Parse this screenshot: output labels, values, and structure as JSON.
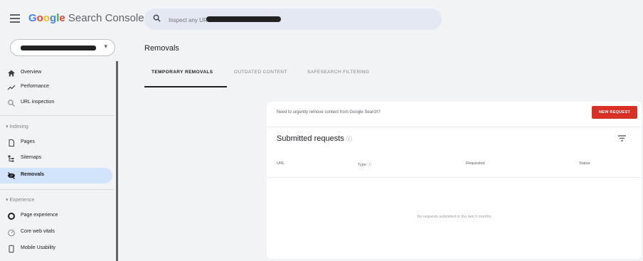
{
  "app": {
    "brand_text": "Search Console",
    "brand_google_letters": [
      "G",
      "o",
      "o",
      "g",
      "l",
      "e"
    ],
    "brand_colors": [
      "#4285f4",
      "#ea4335",
      "#fbbc05",
      "#4285f4",
      "#34a853",
      "#ea4335"
    ]
  },
  "search": {
    "placeholder": "Inspect any URL in"
  },
  "sidebar": {
    "items_top": [
      {
        "label": "Overview",
        "icon": "home-icon"
      },
      {
        "label": "Performance",
        "icon": "trending-up-icon"
      },
      {
        "label": "URL inspection",
        "icon": "search-icon"
      }
    ],
    "indexing_header": "Indexing",
    "indexing_items": [
      {
        "label": "Pages",
        "icon": "pages-icon"
      },
      {
        "label": "Sitemaps",
        "icon": "sitemap-icon"
      },
      {
        "label": "Removals",
        "icon": "removals-eye-icon",
        "active": true
      }
    ],
    "experience_header": "Experience",
    "experience_items": [
      {
        "label": "Page experience",
        "icon": "page-experience-icon"
      },
      {
        "label": "Core web vitals",
        "icon": "speed-icon"
      },
      {
        "label": "Mobile Usability",
        "icon": "mobile-icon"
      }
    ]
  },
  "page": {
    "title": "Removals",
    "tabs": [
      "TEMPORARY REMOVALS",
      "OUTDATED CONTENT",
      "SAFESEARCH FILTERING"
    ],
    "active_tab": 0
  },
  "card": {
    "banner_text": "Need to urgently remove content from Google Search?",
    "new_request_label": "NEW REQUEST",
    "submitted_title": "Submitted requests",
    "columns": [
      "URL",
      "Type",
      "Requested",
      "Status"
    ],
    "empty_text": "No requests submitted in the last 6 months",
    "accent_color": "#d93025"
  }
}
